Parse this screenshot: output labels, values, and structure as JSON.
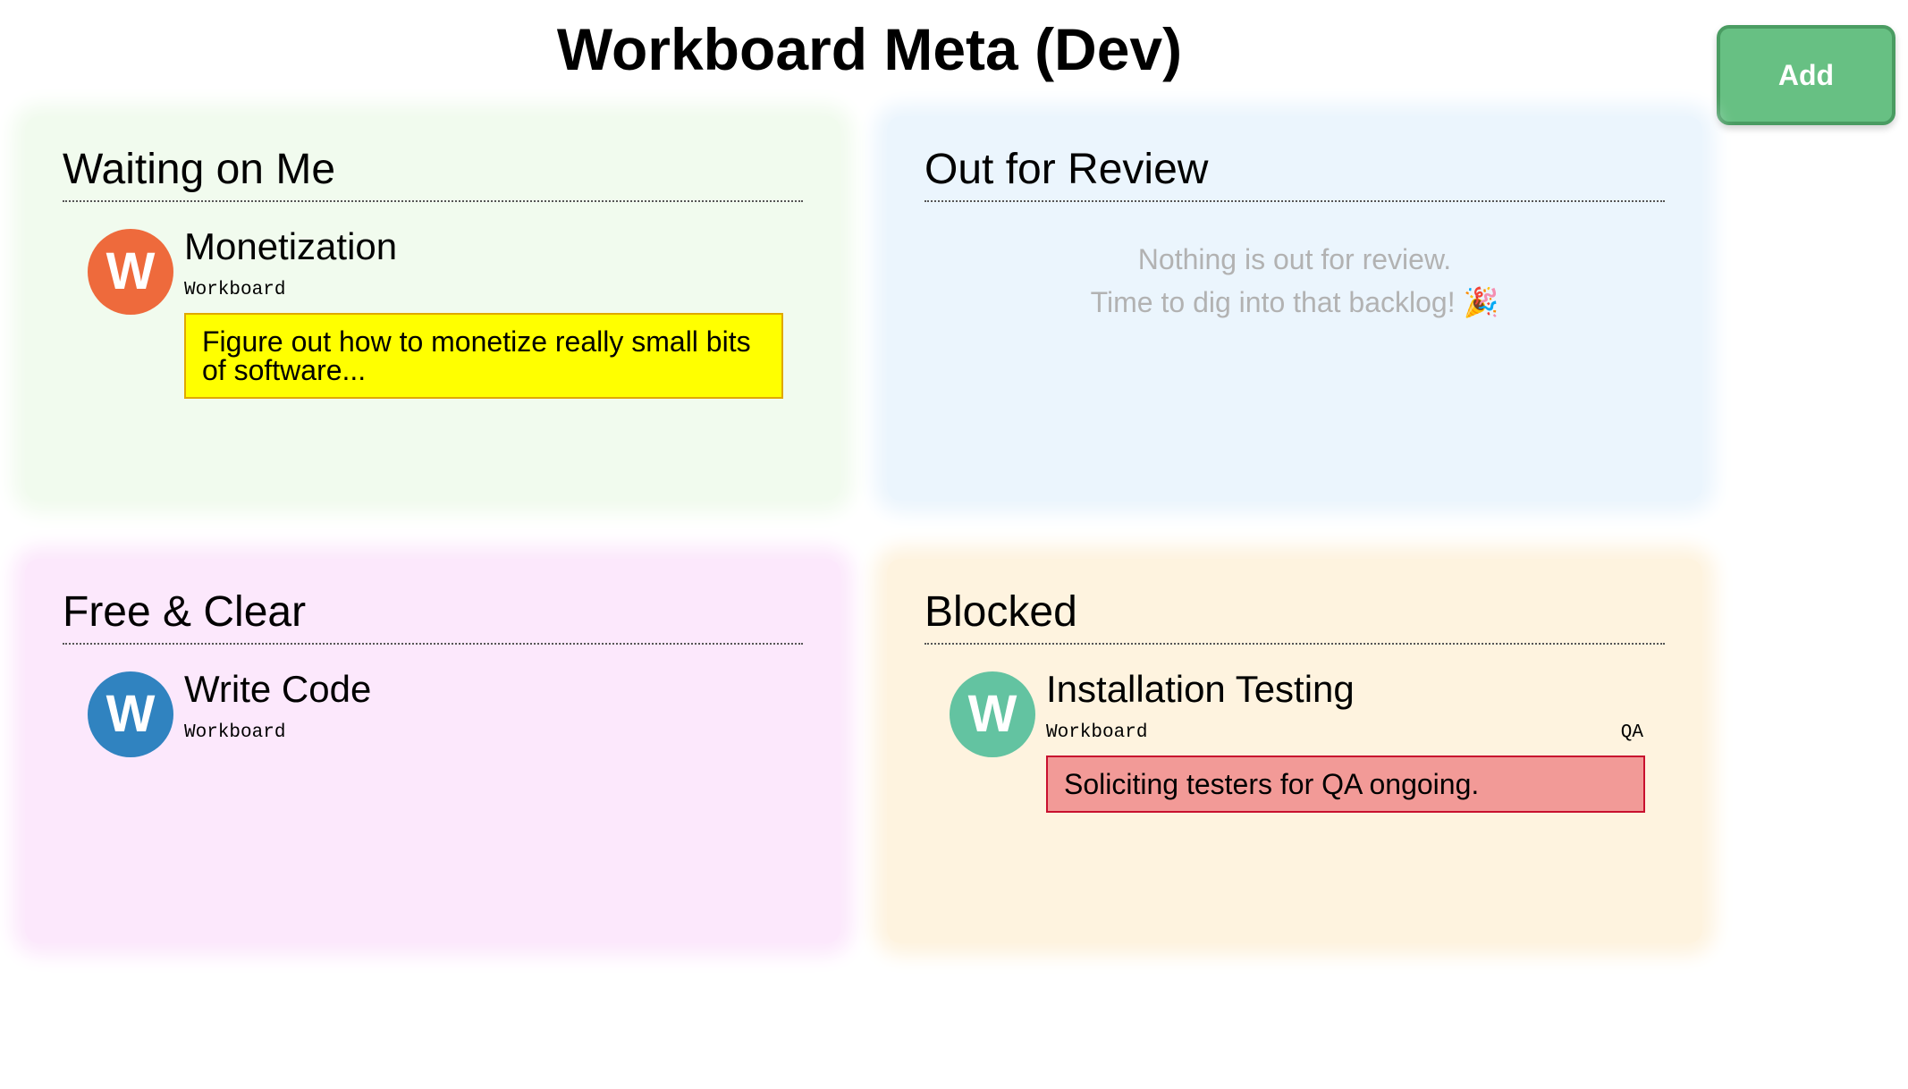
{
  "header": {
    "title": "Workboard Meta (Dev)",
    "add_label": "Add",
    "add_color": "#67c083"
  },
  "panels": {
    "waiting": {
      "heading": "Waiting on Me",
      "bg_color": "#f1fbee",
      "cards": [
        {
          "avatar_letter": "W",
          "avatar_color": "#ee6a3c",
          "title": "Monetization",
          "project": "Workboard",
          "tag": "",
          "note": "Figure out how to monetize really small bits of software...",
          "note_color": "#ffff00"
        }
      ]
    },
    "review": {
      "heading": "Out for Review",
      "bg_color": "#ebf5fd",
      "empty_line1": "Nothing is out for review.",
      "empty_line2": "Time to dig into that backlog! 🎉"
    },
    "free": {
      "heading": "Free & Clear",
      "bg_color": "#fce8fc",
      "cards": [
        {
          "avatar_letter": "W",
          "avatar_color": "#3083c0",
          "title": "Write Code",
          "project": "Workboard",
          "tag": ""
        }
      ]
    },
    "blocked": {
      "heading": "Blocked",
      "bg_color": "#fef3df",
      "cards": [
        {
          "avatar_letter": "W",
          "avatar_color": "#63c3a1",
          "title": "Installation Testing",
          "project": "Workboard",
          "tag": "QA",
          "note": "Soliciting testers for QA ongoing.",
          "note_color": "#f29a97"
        }
      ]
    }
  }
}
